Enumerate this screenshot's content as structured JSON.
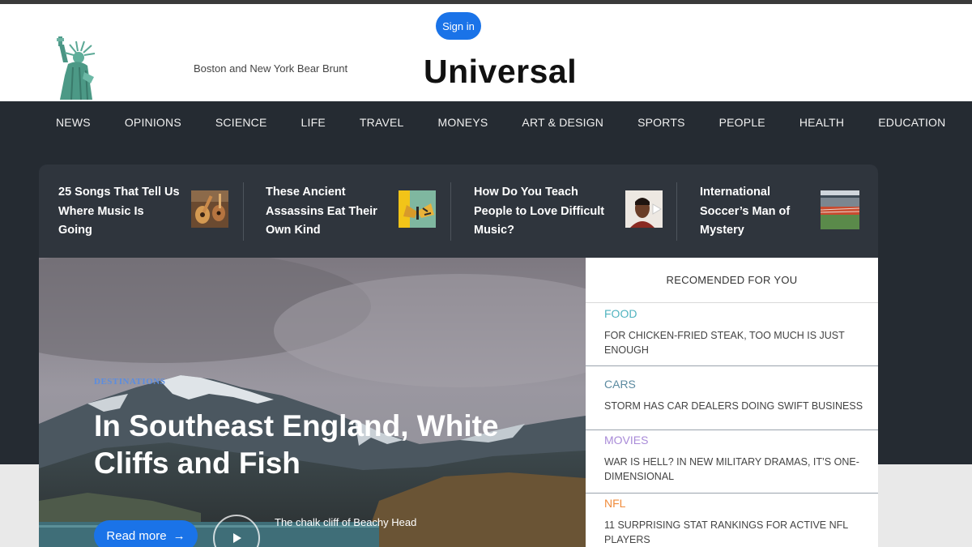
{
  "header": {
    "signin_label": "Sign in",
    "tagline": "Boston and New York Bear Brunt",
    "brand": "Universal",
    "logo_icon": "statue-of-liberty-icon"
  },
  "nav": {
    "items": [
      "NEWS",
      "OPINIONS",
      "SCIENCE",
      "LIFE",
      "TRAVEL",
      "MONEYS",
      "ART & DESIGN",
      "SPORTS",
      "PEOPLE",
      "HEALTH",
      "EDUCATION"
    ]
  },
  "stories": [
    {
      "title_lines": [
        "25 Songs That Tell Us",
        "Where Music Is",
        "Going"
      ],
      "thumb_icon": "guitar-icon"
    },
    {
      "title_lines": [
        "These Ancient",
        "Assassins Eat Their",
        "Own Kind"
      ],
      "thumb_icon": "butterfly-icon"
    },
    {
      "title_lines": [
        "How Do You Teach",
        "People to Love Difficult",
        "Music?"
      ],
      "thumb_icon": "portrait-play-icon"
    },
    {
      "title_lines": [
        "International",
        "Soccer’s Man of",
        "Mystery"
      ],
      "thumb_icon": "stadium-icon"
    }
  ],
  "hero": {
    "category": "DESTINATIONS",
    "title": "In Southeast England, White Cliffs and Fish",
    "read_more": "Read more",
    "read_more_arrow": "→",
    "caption": "The chalk cliff of Beachy Head",
    "colors": {
      "accent": "#1a73e8",
      "category": "#5b8de0"
    }
  },
  "recommended": {
    "heading": "RECOMENDED FOR YOU",
    "items": [
      {
        "category": "FOOD",
        "color": "#4fb3bf",
        "text": "FOR CHICKEN-FRIED STEAK, TOO MUCH IS JUST ENOUGH"
      },
      {
        "category": "CARS",
        "color": "#5b8aa0",
        "text": "STORM HAS CAR DEALERS DOING SWIFT BUSINESS"
      },
      {
        "category": "MOVIES",
        "color": "#a98bd8",
        "text": "WAR IS HELL? IN NEW MILITARY DRAMAS, IT’S ONE-DIMENSIONAL"
      },
      {
        "category": "NFL",
        "color": "#f08c3c",
        "text": "11 SURPRISING STAT RANKINGS FOR ACTIVE NFL PLAYERS"
      }
    ]
  }
}
